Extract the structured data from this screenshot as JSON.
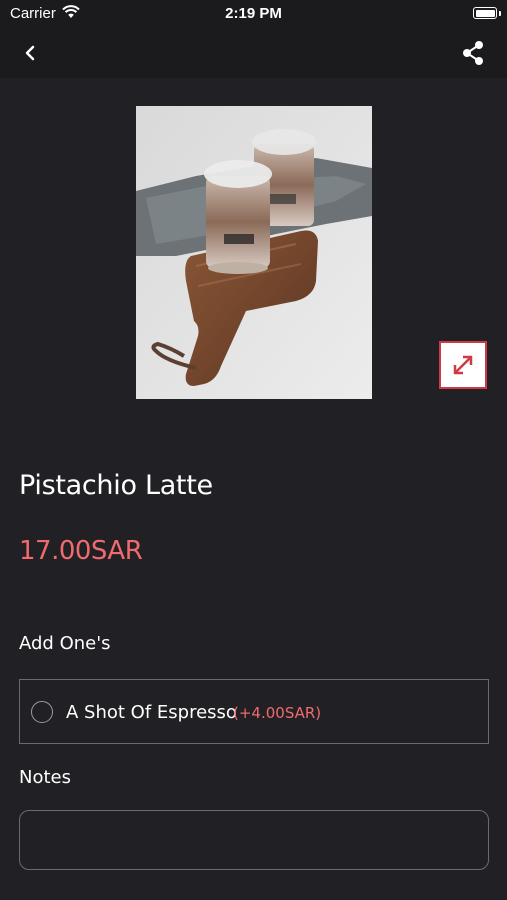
{
  "status_bar": {
    "carrier": "Carrier",
    "time": "2:19 PM",
    "wifi_icon": "wifi-icon",
    "battery_icon": "battery-icon"
  },
  "nav": {
    "back_icon": "chevron-left-icon",
    "share_icon": "share-icon"
  },
  "product": {
    "name": "Pistachio Latte",
    "price": "17.00SAR",
    "image": "iced-latte-cups-on-wooden-board-photo",
    "expand_icon": "expand-icon"
  },
  "addons": {
    "title": "Add One's",
    "items": [
      {
        "label": "A Shot Of Espresso",
        "price": "(+4.00SAR)",
        "selected": false
      }
    ]
  },
  "notes": {
    "title": "Notes",
    "value": "",
    "placeholder": ""
  },
  "colors": {
    "background": "#212125",
    "bar": "#1b1b1e",
    "accent": "#f06a6e",
    "expand_border": "#d03a45"
  }
}
